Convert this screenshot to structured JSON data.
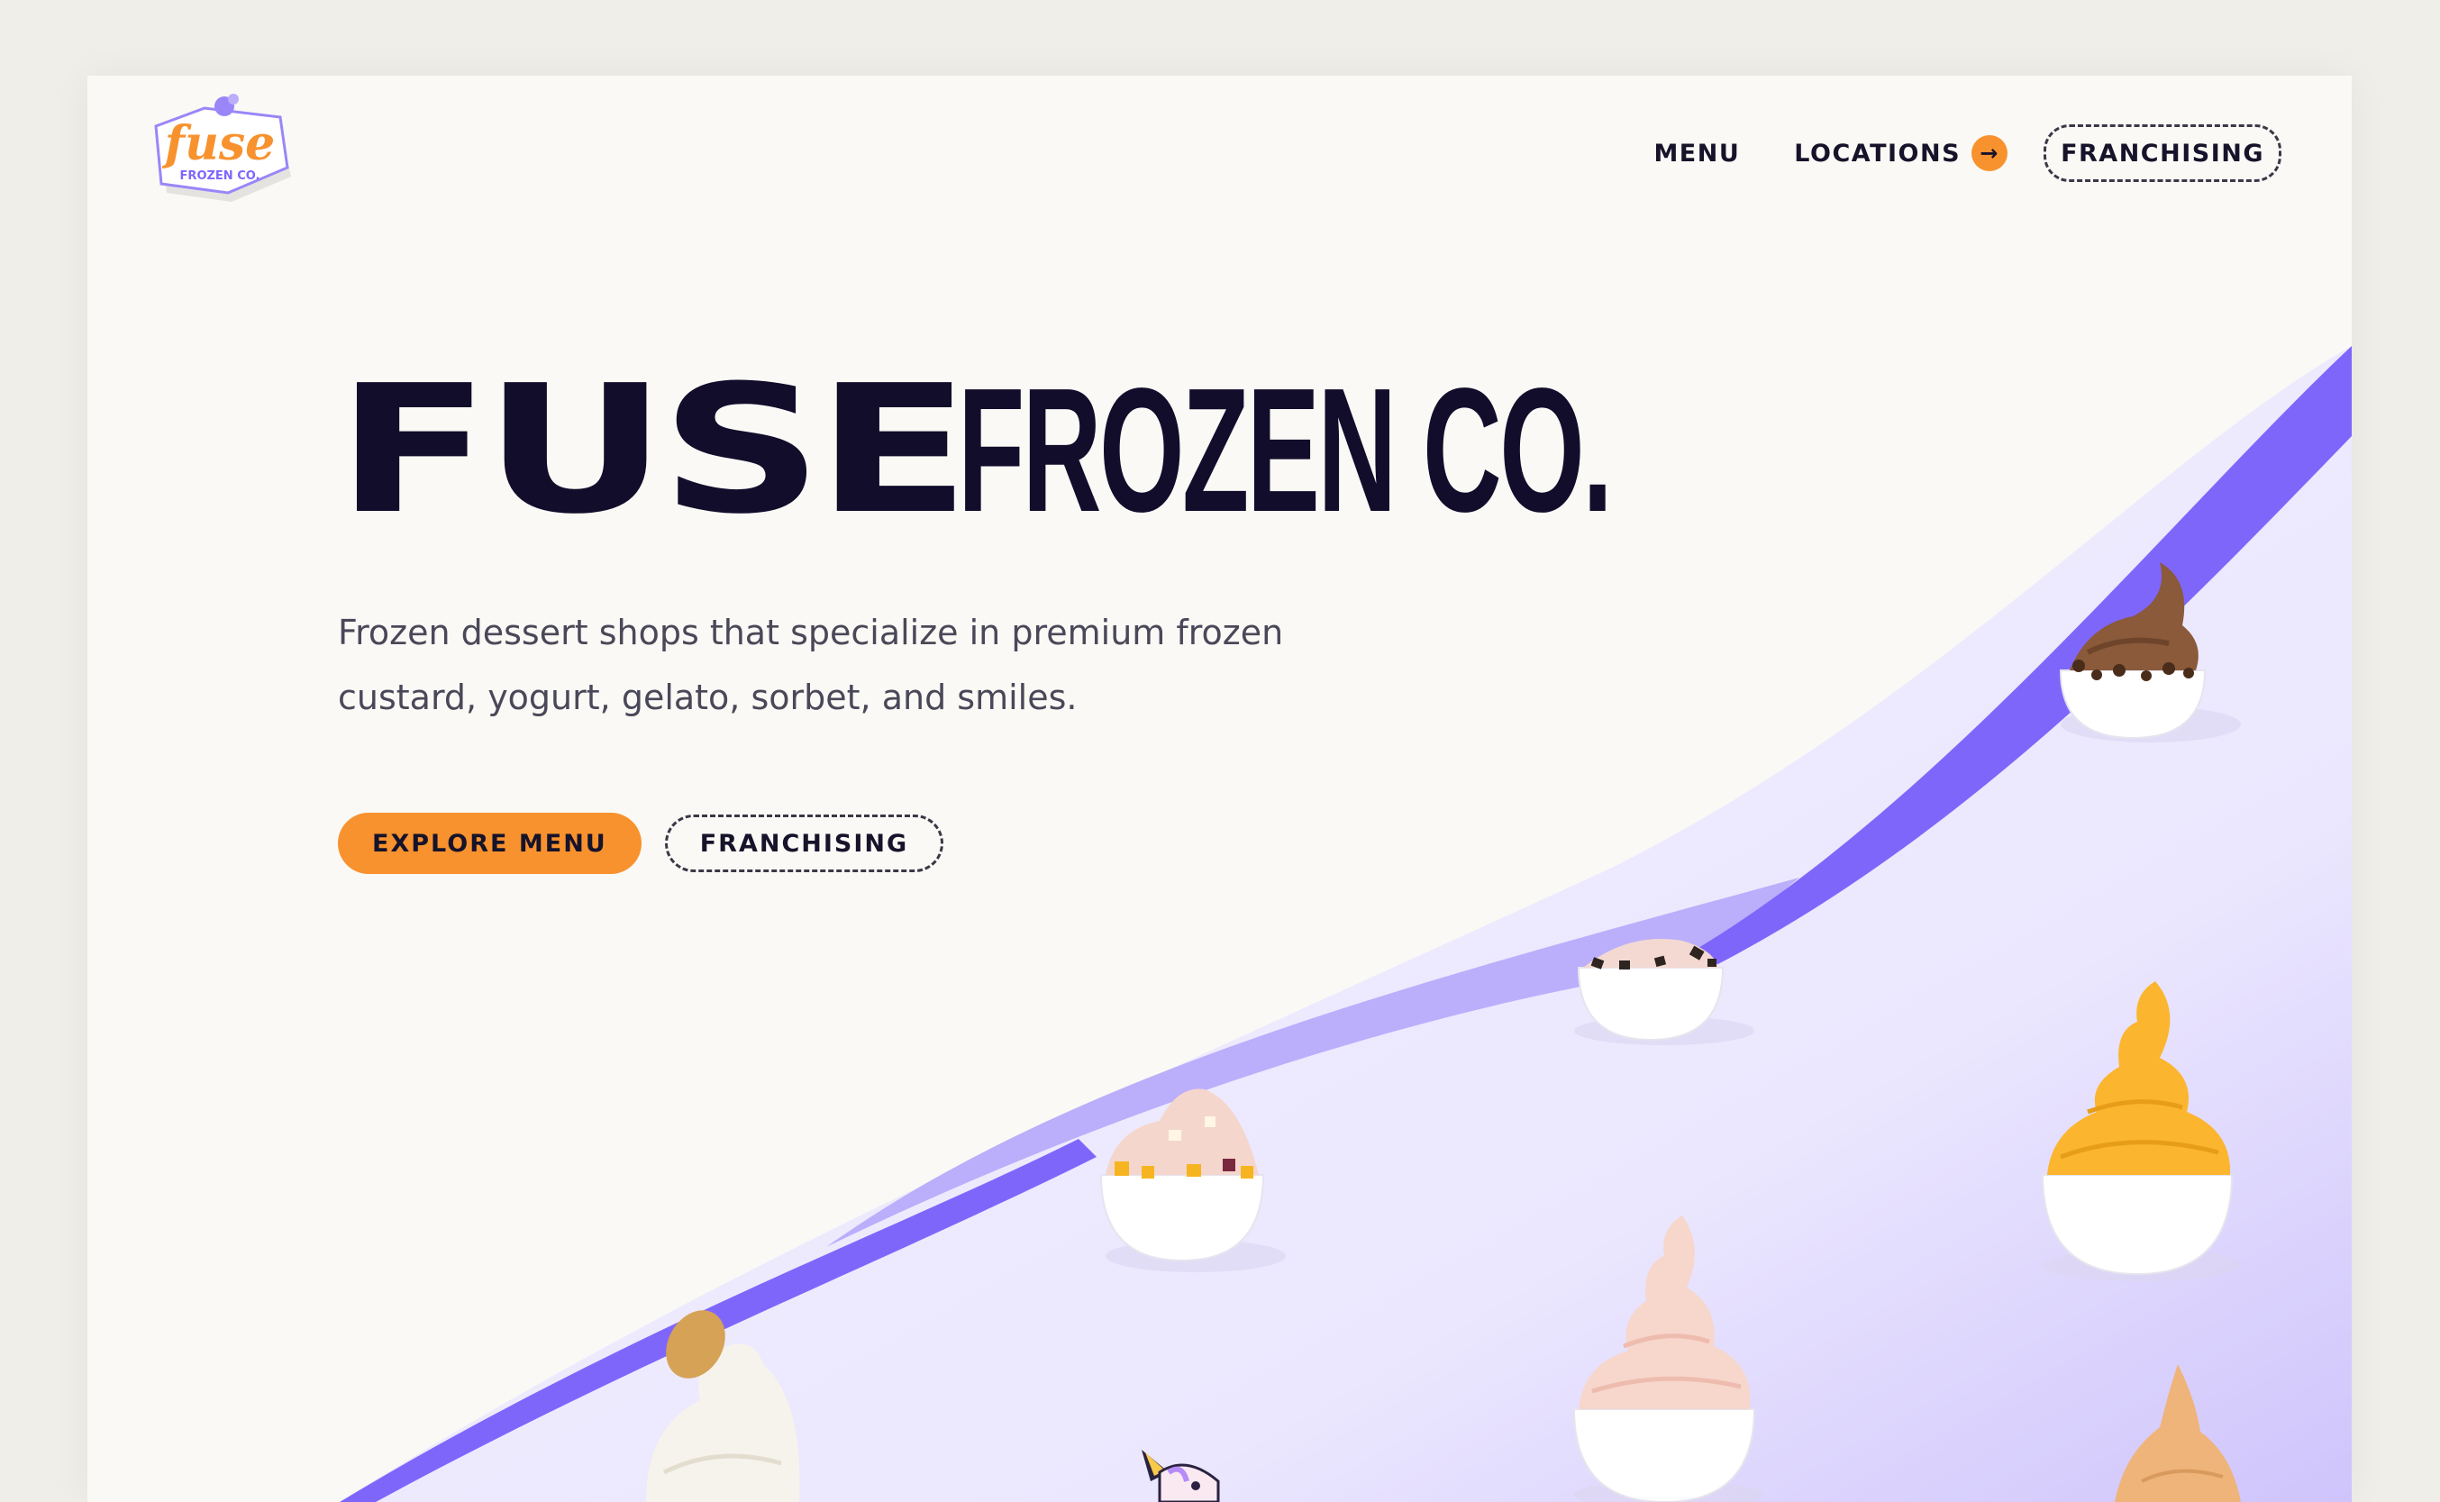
{
  "brand": {
    "logo_word": "fuse",
    "logo_sub": "FROZEN CO."
  },
  "nav": {
    "menu_label": "MENU",
    "locations_label": "LOCATIONS",
    "franchising_label": "FRANCHISING"
  },
  "hero": {
    "title_bold": "FUSE",
    "title_condensed": "FROZEN CO.",
    "subtitle": "Frozen dessert shops that specialize in premium frozen custard, yogurt, gelato, sorbet, and smiles.",
    "primary_cta": "EXPLORE MENU",
    "secondary_cta": "FRANCHISING"
  },
  "icons": {
    "locations_arrow": "arrow-right-icon"
  },
  "colors": {
    "background": "#faf9f5",
    "outer": "#f0eee8",
    "ink": "#110d2b",
    "accent_orange": "#f8922e",
    "purple": "#7f66fb",
    "lavender": "#bbaefb",
    "lilac_bg": "#eeebfe"
  }
}
